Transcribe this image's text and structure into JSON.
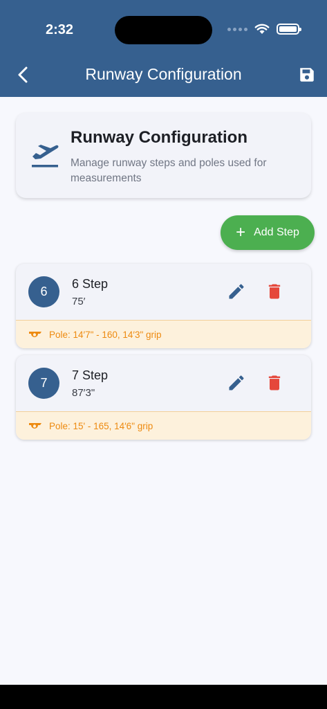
{
  "status_bar": {
    "time": "2:32"
  },
  "nav": {
    "title": "Runway Configuration"
  },
  "header": {
    "title": "Runway Configuration",
    "description": "Manage runway steps and poles used for measurements"
  },
  "add_step_label": "Add Step",
  "steps": [
    {
      "number": "6",
      "name": "6 Step",
      "distance": "75′",
      "pole": "Pole: 14′7\" - 160, 14′3\" grip"
    },
    {
      "number": "7",
      "name": "7 Step",
      "distance": "87′3\"",
      "pole": "Pole: 15' - 165, 14′6\" grip"
    }
  ],
  "colors": {
    "primary": "#36608f",
    "accent": "#4caf50",
    "danger": "#e5473b",
    "warning": "#ed8a10"
  }
}
